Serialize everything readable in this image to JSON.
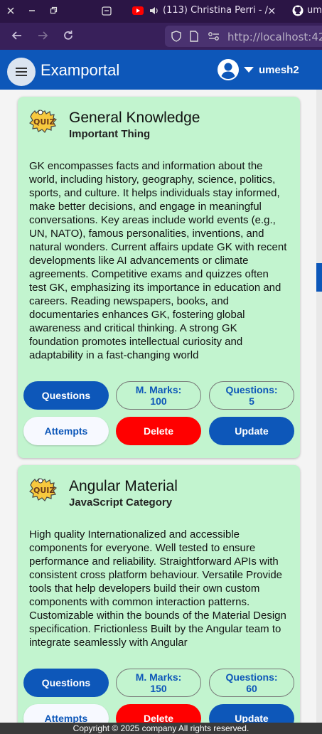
{
  "browser": {
    "tab_title": "(113) Christina Perri - ∕",
    "tab_close": "×",
    "github_tab": "um",
    "url": "http://localhost:42"
  },
  "appbar": {
    "brand": "Examportal",
    "username": "umesh2"
  },
  "quizzes": [
    {
      "title": "General Knowledge",
      "category": "Important Thing",
      "description": "GK encompasses facts and information about the world, including history, geography, science, politics, sports, and culture. It helps individuals stay informed, make better decisions, and engage in meaningful conversations. Key areas include world events (e.g., UN, NATO), famous personalities, inventions, and natural wonders. Current affairs update GK with recent developments like AI advancements or climate agreements. Competitive exams and quizzes often test GK, emphasizing its importance in education and careers. Reading newspapers, books, and documentaries enhances GK, fostering global awareness and critical thinking. A strong GK foundation promotes intellectual curiosity and adaptability in a fast-changing world",
      "questions_label": "Questions",
      "max_marks_label": "M. Marks:",
      "max_marks": "100",
      "num_questions_label": "Questions:",
      "num_questions": "5",
      "attempts_label": "Attempts",
      "delete_label": "Delete",
      "update_label": "Update"
    },
    {
      "title": "Angular Material",
      "category": "JavaScript Category",
      "description": "High quality Internationalized and accessible components for everyone. Well tested to ensure performance and reliability. Straightforward APIs with consistent cross platform behaviour. Versatile Provide tools that help developers build their own custom components with common interaction patterns. Customizable within the bounds of the Material Design specification. Frictionless Built by the Angular team to integrate seamlessly with Angular",
      "questions_label": "Questions",
      "max_marks_label": "M. Marks:",
      "max_marks": "150",
      "num_questions_label": "Questions:",
      "num_questions": "60",
      "attempts_label": "Attempts",
      "delete_label": "Delete",
      "update_label": "Update"
    }
  ],
  "footer": {
    "text": "Copyright © 2025 company All rights reserved."
  },
  "colors": {
    "appbar": "#0d57b9",
    "card": "#c2f4cf",
    "delete": "#ff0000"
  },
  "icons": [
    "menu-icon",
    "account-circle-icon",
    "dropdown-arrow-icon",
    "quiz-icon",
    "back-icon",
    "forward-icon",
    "reload-icon",
    "shield-icon",
    "page-icon",
    "youtube-icon",
    "speaker-icon",
    "github-icon"
  ]
}
